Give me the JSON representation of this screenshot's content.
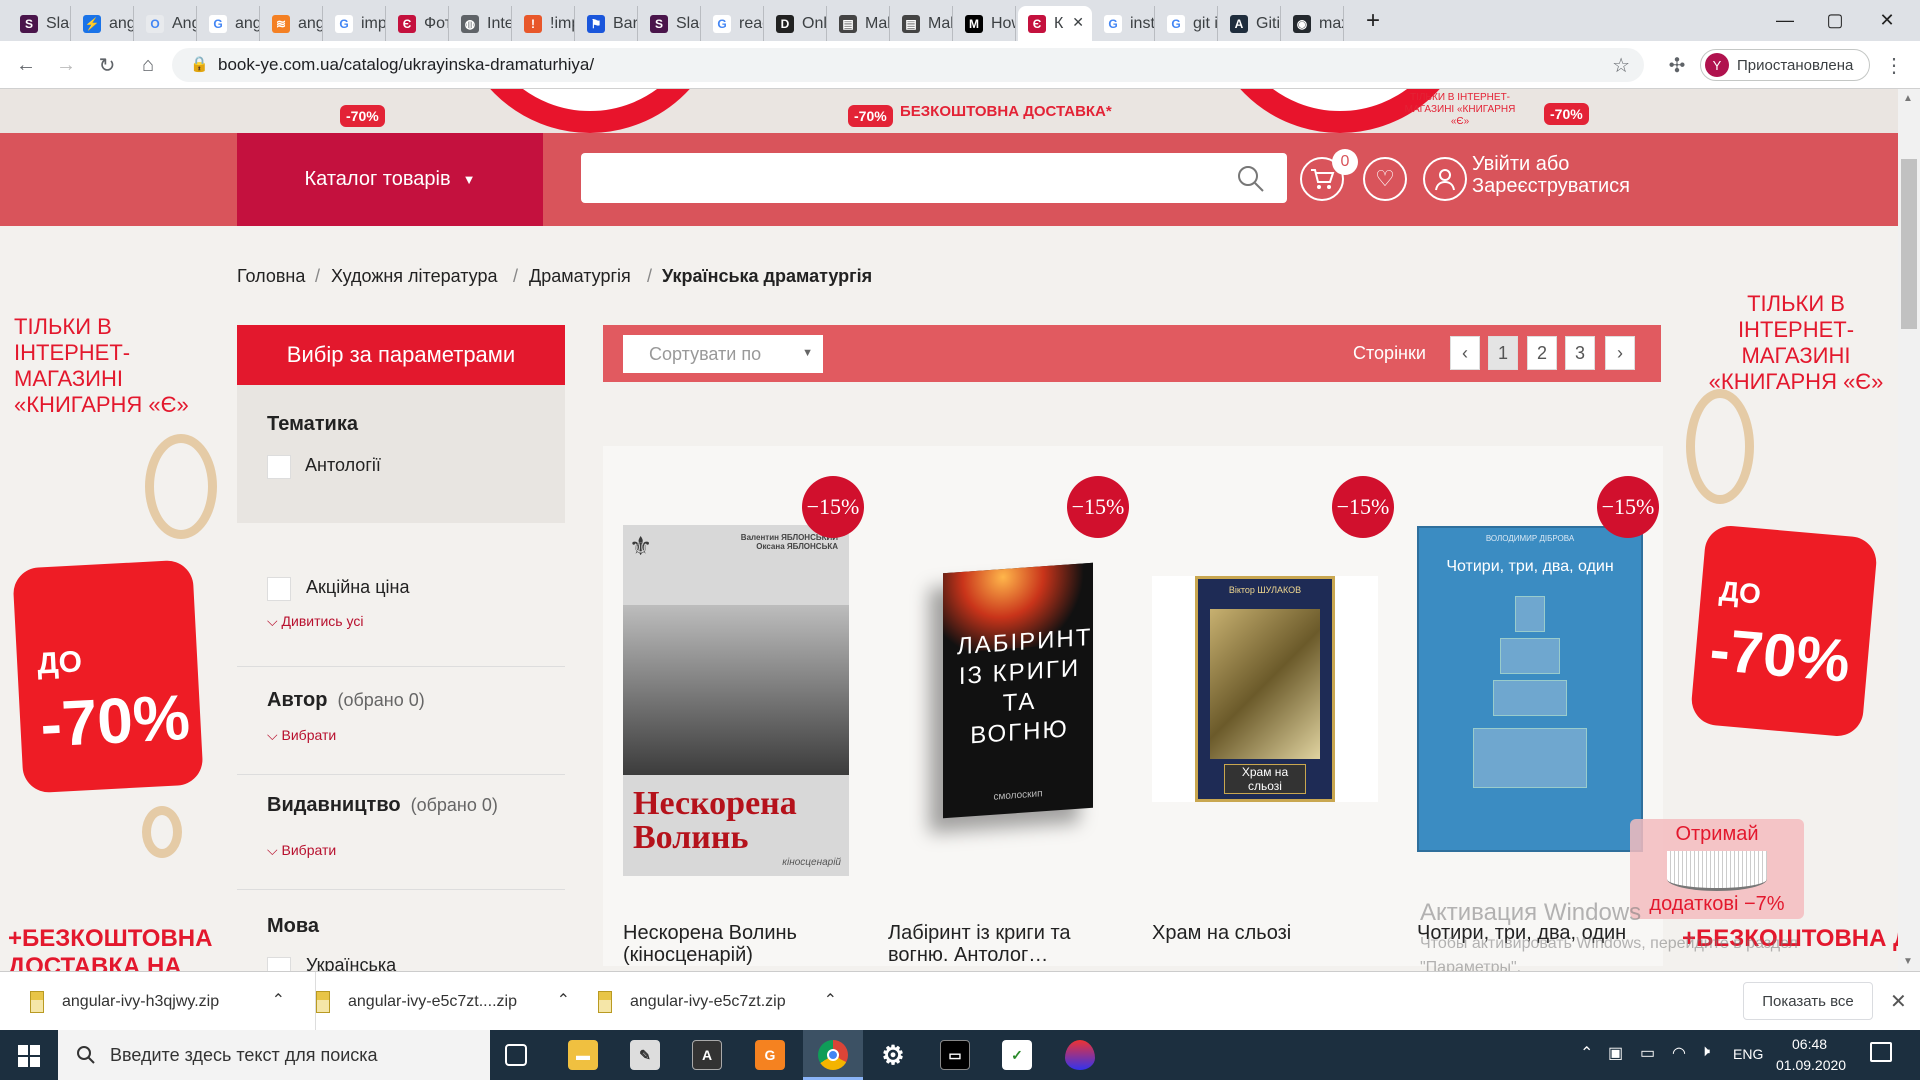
{
  "browser": {
    "tabs": [
      {
        "label": "Slac",
        "color": "#4a154b",
        "glyph": "S"
      },
      {
        "label": "angu",
        "color": "#1a73e8",
        "glyph": "⚡"
      },
      {
        "label": "Ang",
        "color": "#e8eaed",
        "glyph": "O"
      },
      {
        "label": "angu",
        "color": "#fff",
        "glyph": "G"
      },
      {
        "label": "angu",
        "color": "#f48024",
        "glyph": "≋"
      },
      {
        "label": "impo",
        "color": "#fff",
        "glyph": "G"
      },
      {
        "label": "Фот",
        "color": "#c4113e",
        "glyph": "Є"
      },
      {
        "label": "Inte",
        "color": "#5f6368",
        "glyph": "◍"
      },
      {
        "label": "!imp",
        "color": "#e8572a",
        "glyph": "!"
      },
      {
        "label": "Bars",
        "color": "#1a56db",
        "glyph": "⚑"
      },
      {
        "label": "Slac",
        "color": "#4a154b",
        "glyph": "S"
      },
      {
        "label": "reac",
        "color": "#fff",
        "glyph": "G"
      },
      {
        "label": "Onli",
        "color": "#222",
        "glyph": "D"
      },
      {
        "label": "Mak",
        "color": "#444",
        "glyph": "▤"
      },
      {
        "label": "Mak",
        "color": "#444",
        "glyph": "▤"
      },
      {
        "label": "How",
        "color": "#000",
        "glyph": "M"
      },
      {
        "label": "К",
        "color": "#c4113e",
        "glyph": "Є"
      },
      {
        "label": "insta",
        "color": "#fff",
        "glyph": "G"
      },
      {
        "label": "git i",
        "color": "#fff",
        "glyph": "G"
      },
      {
        "label": "Gitig",
        "color": "#1f2d3d",
        "glyph": "A"
      },
      {
        "label": "max",
        "color": "#24292e",
        "glyph": "◉"
      }
    ],
    "active_tab_index": 16,
    "url": "book-ye.com.ua/catalog/ukrayinska-dramaturhiya/",
    "profile_initial": "Y",
    "profile_label": "Приостановлена"
  },
  "promo_strip": {
    "free_delivery": "БЕЗКОШТОВНА ДОСТАВКА*",
    "discount_tag": "-70%",
    "only_online": "ТІЛЬКИ В ІНТЕРНЕТ-МАГАЗИНІ «КНИГАРНЯ «Є»"
  },
  "header": {
    "catalog_label": "Каталог товарів",
    "cart_count": "0",
    "login_line1": "Увійти або",
    "login_line2": "Зареєструватися"
  },
  "breadcrumb": [
    "Головна",
    "Художня література",
    "Драматургія",
    "Українська драматургія"
  ],
  "filters": {
    "title": "Вибір за параметрами",
    "theme_title": "Тематика",
    "theme_option": "Антології",
    "promo_option": "Акційна ціна",
    "see_all": "Дивитись усі",
    "author_title": "Автор",
    "author_selected": "(обрано 0)",
    "choose": "Вибрати",
    "publisher_title": "Видавництво",
    "publisher_selected": "(обрано 0)",
    "language_title": "Мова",
    "language_option": "Українська"
  },
  "sortbar": {
    "sort_label": "Сортувати по",
    "pages_label": "Сторінки",
    "pages": [
      "1",
      "2",
      "3"
    ],
    "current_page": "1"
  },
  "products": [
    {
      "title": "Нескорена Волинь (кіносценарій)",
      "discount": "−15%",
      "cover_title": "Нескорена Волинь",
      "cover_authors": "Валентин ЯБЛОНСЬКИЙ Оксана ЯБЛОНСЬКА",
      "cover_sub": "кіносценарій"
    },
    {
      "title": "Лабіринт із криги та вогню. Антолог…",
      "discount": "−15%",
      "cover_title": "ЛАБІРИНТ ІЗ КРИГИ ТА ВОГНЮ",
      "cover_sub": "смолоскип"
    },
    {
      "title": "Храм на сльозі",
      "discount": "−15%",
      "cover_title": "Храм на сльозі",
      "cover_authors": "Віктор ШУЛАКОВ"
    },
    {
      "title": "Чотири, три, два, один",
      "discount": "−15%",
      "cover_title": "Чотири, три, два, один",
      "cover_authors": "ВОЛОДИМИР ДІБРОВА"
    }
  ],
  "side_banners": {
    "left_text": "ТІЛЬКИ В ІНТЕРНЕТ-МАГАЗИНІ «КНИГАРНЯ «Є»",
    "upto": "ДО",
    "discount": "-70%",
    "free_delivery": "+БЕЗКОШТОВНА ДОСТАВКА НА"
  },
  "get_extra": {
    "line1": "Отримай",
    "line2": "додаткові −7%"
  },
  "windows_watermark": {
    "line1": "Активация Windows",
    "line2": "Чтобы активировать Windows, перейдите в раздел",
    "line3": "\"Параметры\"."
  },
  "downloads": {
    "items": [
      "angular-ivy-h3qjwy.zip",
      "angular-ivy-e5c7zt....zip",
      "angular-ivy-e5c7zt.zip"
    ],
    "show_all": "Показать все"
  },
  "taskbar": {
    "search_placeholder": "Введите здесь текст для поиска",
    "lang": "ENG",
    "time": "06:48",
    "date": "01.09.2020"
  }
}
